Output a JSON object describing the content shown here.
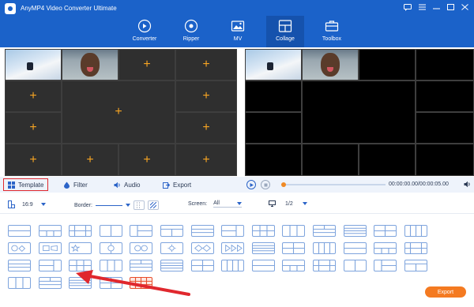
{
  "window": {
    "title": "AnyMP4 Video Converter Ultimate",
    "controls": [
      "chat-icon",
      "menu-icon",
      "minimize-icon",
      "maximize-icon",
      "close-icon"
    ]
  },
  "nav": {
    "tabs": [
      {
        "label": "Converter",
        "icon": "converter-icon",
        "active": false
      },
      {
        "label": "Ripper",
        "icon": "ripper-icon",
        "active": false
      },
      {
        "label": "MV",
        "icon": "mv-icon",
        "active": false
      },
      {
        "label": "Collage",
        "icon": "collage-icon",
        "active": true
      },
      {
        "label": "Toolbox",
        "icon": "toolbox-icon",
        "active": false
      }
    ]
  },
  "editor": {
    "add_glyph": "+",
    "clip_1": "ski-jump-thumbnail",
    "clip_2": "face-thumbnail"
  },
  "toolbar": {
    "template_label": "Template",
    "filter_label": "Filter",
    "audio_label": "Audio",
    "export_label": "Export",
    "active_tab": "Template"
  },
  "player": {
    "time": "00:00:00.00/00:00:05.00",
    "progress": 0.0
  },
  "options": {
    "ratio": "16:9",
    "border_label": "Border:",
    "screen_label": "Screen:",
    "screen_value": "All",
    "page": "1/2"
  },
  "templates": {
    "selected_index": 46,
    "count": 47
  },
  "footer": {
    "export_button": "Export"
  },
  "colors": {
    "brand": "#1b62c9",
    "accent": "#f47a21",
    "highlight": "#e0282e",
    "template_outline": "#7ea4dd",
    "plus": "#f6a423"
  }
}
